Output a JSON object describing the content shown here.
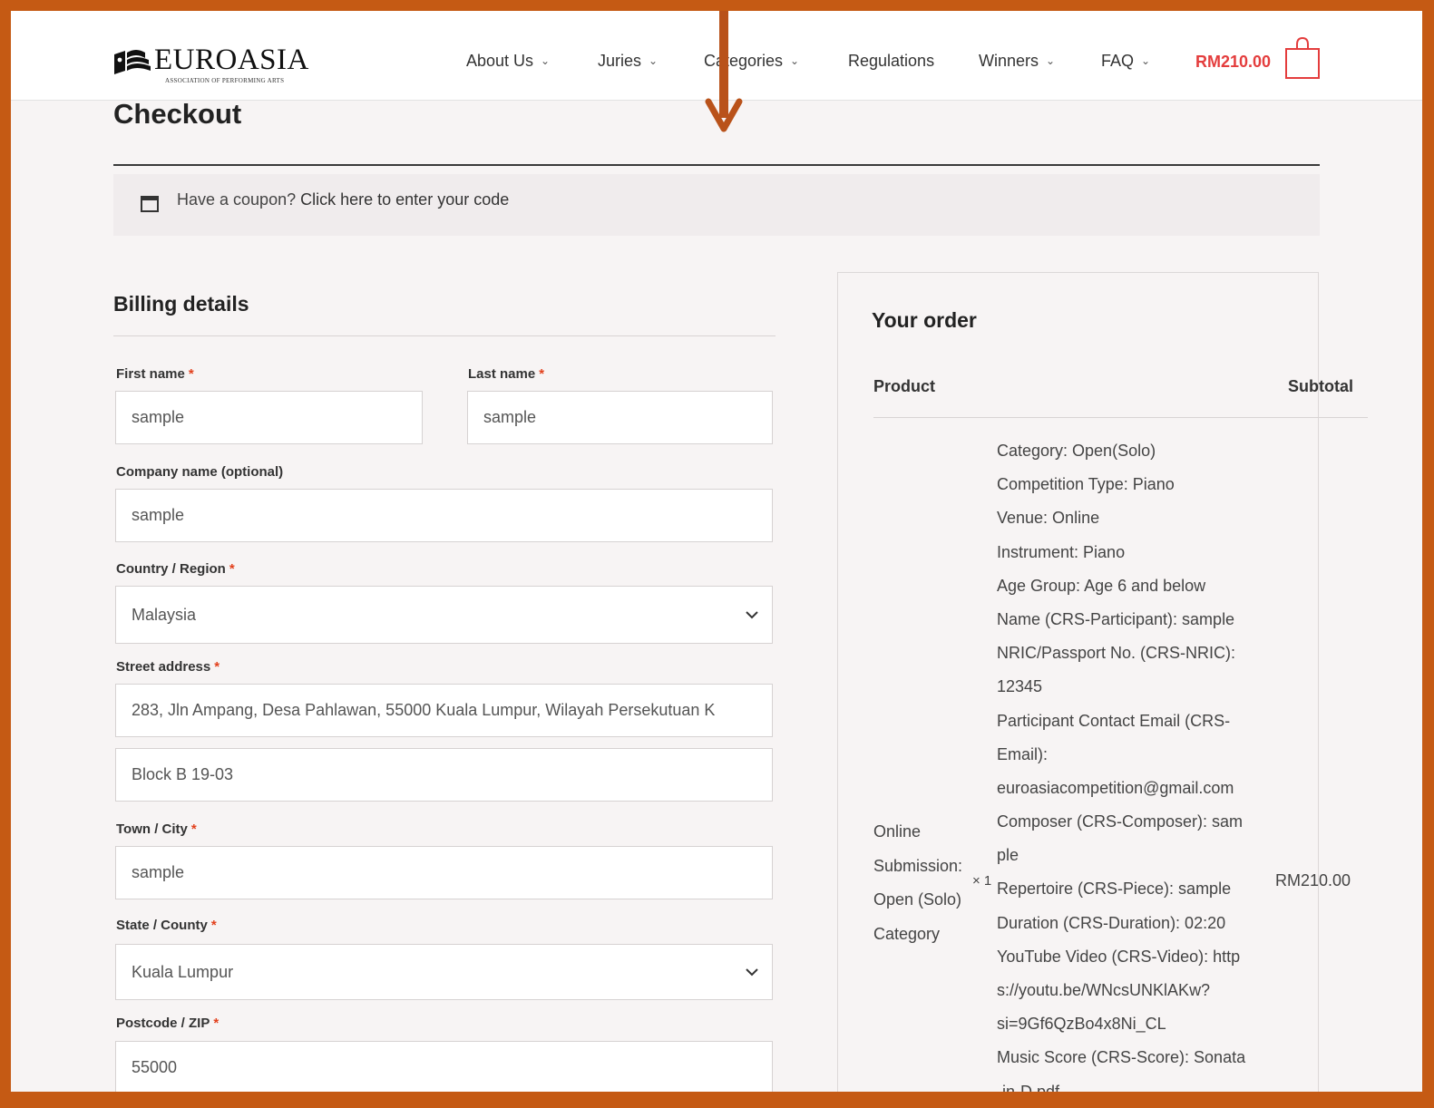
{
  "brand": {
    "name": "EUROASIA",
    "subtitle": "ASSOCIATION OF PERFORMING ARTS"
  },
  "nav": {
    "items": [
      {
        "label": "About Us"
      },
      {
        "label": "Juries"
      },
      {
        "label": "Categories"
      },
      {
        "label": "Regulations"
      },
      {
        "label": "Winners"
      },
      {
        "label": "FAQ"
      }
    ],
    "cart_total": "RM210.00"
  },
  "page": {
    "title": "Checkout"
  },
  "coupon": {
    "prefix": "Have a coupon?",
    "link": "Click here to enter your code"
  },
  "billing": {
    "title": "Billing details",
    "first_name": {
      "label": "First name",
      "value": "sample"
    },
    "last_name": {
      "label": "Last name",
      "value": "sample"
    },
    "company": {
      "label": "Company name (optional)",
      "value": "sample"
    },
    "country": {
      "label": "Country / Region",
      "value": "Malaysia"
    },
    "street": {
      "label": "Street address",
      "line1": "283, Jln Ampang, Desa Pahlawan, 55000 Kuala Lumpur, Wilayah Persekutuan K",
      "line2": "Block B 19-03"
    },
    "city": {
      "label": "Town / City",
      "value": "sample"
    },
    "state": {
      "label": "State / County",
      "value": "Kuala Lumpur"
    },
    "postcode": {
      "label": "Postcode / ZIP",
      "value": "55000"
    },
    "required_mark": "*"
  },
  "order": {
    "title": "Your order",
    "col_product": "Product",
    "col_subtotal": "Subtotal",
    "item": {
      "name_lines": [
        "Online",
        "Submission:",
        "Open (Solo)",
        "Category"
      ],
      "quantity": "× 1",
      "subtotal": "RM210.00",
      "meta_lines": [
        "Category: Open(Solo)",
        "Competition Type: Piano",
        "Venue: Online",
        "Instrument: Piano",
        "Age Group: Age 6 and below",
        "Name (CRS-Participant): sample",
        "NRIC/Passport No. (CRS-NRIC):",
        "12345",
        "Participant Contact Email (CRS-",
        "Email):",
        "euroasiacompetition@gmail.com",
        "Composer (CRS-Composer): sam",
        "ple",
        "Repertoire (CRS-Piece): sample",
        "Duration (CRS-Duration): 02:20",
        "YouTube Video (CRS-Video): http",
        "s://youtu.be/WNcsUNKlAKw?",
        "si=9Gf6QzBo4x8Ni_CL",
        "Music Score (CRS-Score): Sonata",
        "-in-D.pdf"
      ]
    }
  },
  "colors": {
    "accent": "#e43d3d",
    "frame": "#c55a14",
    "required": "#e2401c"
  }
}
